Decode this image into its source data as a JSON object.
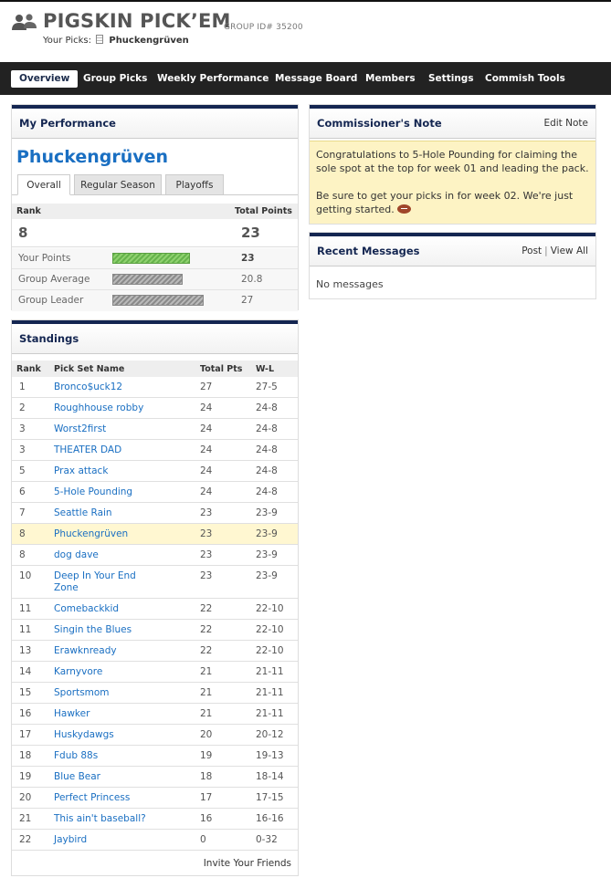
{
  "header": {
    "title": "PIGSKIN PICK’EM",
    "group_id": "GROUP ID# 35200",
    "your_picks_label": "Your Picks:",
    "pick_name": "Phuckengrüven"
  },
  "nav": {
    "items": [
      "Overview",
      "Group Picks",
      "Weekly Performance",
      "Message Board",
      "Members",
      "Settings",
      "Commish Tools"
    ],
    "active": "Overview"
  },
  "performance": {
    "heading": "My Performance",
    "name": "Phuckengrüven",
    "tabs": [
      "Overall",
      "Regular Season",
      "Playoffs"
    ],
    "active_tab": "Overall",
    "rank_label": "Rank",
    "total_label": "Total Points",
    "rank": "8",
    "total": "23",
    "rows": [
      {
        "label": "Your Points",
        "value": "23",
        "bar_fraction": 0.852
      },
      {
        "label": "Group Average",
        "value": "20.8",
        "bar_fraction": 0.77
      },
      {
        "label": "Group Leader",
        "value": "27",
        "bar_fraction": 1.0
      }
    ]
  },
  "standings": {
    "heading": "Standings",
    "columns": [
      "Rank",
      "Pick Set Name",
      "Total Pts",
      "W-L"
    ],
    "rows": [
      {
        "rank": "1",
        "name": "Bronco$uck12",
        "pts": "27",
        "wl": "27-5"
      },
      {
        "rank": "2",
        "name": "Roughhouse robby",
        "pts": "24",
        "wl": "24-8"
      },
      {
        "rank": "3",
        "name": "Worst2first",
        "pts": "24",
        "wl": "24-8"
      },
      {
        "rank": "3",
        "name": "THEATER DAD",
        "pts": "24",
        "wl": "24-8"
      },
      {
        "rank": "5",
        "name": "Prax attack",
        "pts": "24",
        "wl": "24-8"
      },
      {
        "rank": "6",
        "name": "5-Hole Pounding",
        "pts": "24",
        "wl": "24-8"
      },
      {
        "rank": "7",
        "name": "Seattle Rain",
        "pts": "23",
        "wl": "23-9"
      },
      {
        "rank": "8",
        "name": "Phuckengrüven",
        "pts": "23",
        "wl": "23-9",
        "me": true
      },
      {
        "rank": "8",
        "name": "dog dave",
        "pts": "23",
        "wl": "23-9"
      },
      {
        "rank": "10",
        "name": "Deep In Your End Zone",
        "pts": "23",
        "wl": "23-9",
        "tall": true
      },
      {
        "rank": "11",
        "name": "Comebackkid",
        "pts": "22",
        "wl": "22-10"
      },
      {
        "rank": "11",
        "name": "Singin the Blues",
        "pts": "22",
        "wl": "22-10"
      },
      {
        "rank": "13",
        "name": "Erawknready",
        "pts": "22",
        "wl": "22-10"
      },
      {
        "rank": "14",
        "name": "Karnyvore",
        "pts": "21",
        "wl": "21-11"
      },
      {
        "rank": "15",
        "name": "Sportsmom",
        "pts": "21",
        "wl": "21-11"
      },
      {
        "rank": "16",
        "name": "Hawker",
        "pts": "21",
        "wl": "21-11"
      },
      {
        "rank": "17",
        "name": "Huskydawgs",
        "pts": "20",
        "wl": "20-12"
      },
      {
        "rank": "18",
        "name": "Fdub 88s",
        "pts": "19",
        "wl": "19-13"
      },
      {
        "rank": "19",
        "name": "Blue Bear",
        "pts": "18",
        "wl": "18-14"
      },
      {
        "rank": "20",
        "name": "Perfect Princess",
        "pts": "17",
        "wl": "17-15"
      },
      {
        "rank": "21",
        "name": "This ain't baseball?",
        "pts": "16",
        "wl": "16-16"
      },
      {
        "rank": "22",
        "name": "Jaybird",
        "pts": "0",
        "wl": "0-32"
      }
    ],
    "invite_label": "Invite Your Friends"
  },
  "commish_note": {
    "heading": "Commissioner's Note",
    "edit_label": "Edit Note",
    "paragraph1": "Congratulations to 5-Hole Pounding for claiming the sole spot at the top for week 01 and leading the pack.",
    "paragraph2": "Be sure to get your picks in for week 02. We're just getting started."
  },
  "messages": {
    "heading": "Recent Messages",
    "post_label": "Post",
    "separator": "|",
    "view_all_label": "View All",
    "empty_text": "No messages"
  },
  "colors": {
    "navy": "#142651",
    "link": "#1a6fc2",
    "nav_bg": "#222222",
    "highlight_row": "#fff7d1",
    "note_bg": "#fdf3c4",
    "bar_green": "#66b34c"
  }
}
